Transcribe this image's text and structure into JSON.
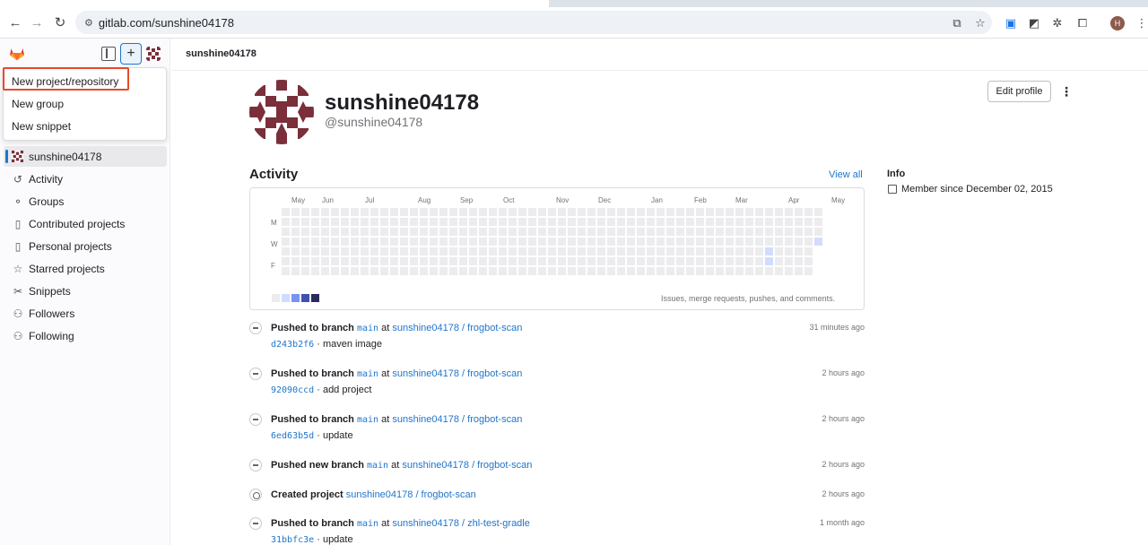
{
  "browser": {
    "url": "gitlab.com/sunshine04178",
    "back_icon": "arrow-left-icon",
    "forward_icon": "arrow-right-icon",
    "reload_icon": "reload-icon"
  },
  "sidebar": {
    "new_menu": {
      "items": [
        "New project/repository",
        "New group",
        "New snippet"
      ]
    },
    "nav": [
      {
        "label": "sunshine04178",
        "icon": "user-avatar-icon",
        "active": true
      },
      {
        "label": "Activity",
        "icon": "history-icon"
      },
      {
        "label": "Groups",
        "icon": "group-icon"
      },
      {
        "label": "Contributed projects",
        "icon": "project-icon"
      },
      {
        "label": "Personal projects",
        "icon": "project-icon"
      },
      {
        "label": "Starred projects",
        "icon": "star-icon"
      },
      {
        "label": "Snippets",
        "icon": "snippet-icon"
      },
      {
        "label": "Followers",
        "icon": "users-icon"
      },
      {
        "label": "Following",
        "icon": "users-icon"
      }
    ]
  },
  "topbar": {
    "breadcrumb": "sunshine04178"
  },
  "profile": {
    "name": "sunshine04178",
    "handle": "@sunshine04178",
    "edit_label": "Edit profile"
  },
  "activity": {
    "title": "Activity",
    "view_all": "View all",
    "months": [
      "May",
      "Jun",
      "Jul",
      "Aug",
      "Sep",
      "Oct",
      "Nov",
      "Dec",
      "Jan",
      "Feb",
      "Mar",
      "Apr",
      "May"
    ],
    "day_labels": [
      "M",
      "W",
      "F"
    ],
    "legend_text": "Issues, merge requests, pushes, and comments.",
    "legend_colors": [
      "#ececef",
      "#d2dcff",
      "#7992f5",
      "#3f51ae",
      "#2a2b59"
    ]
  },
  "info": {
    "title": "Info",
    "member_since": "Member since December 02, 2015"
  },
  "events": [
    {
      "action": "Pushed to branch",
      "branch": "main",
      "at": "at",
      "project": "sunshine04178 / frogbot-scan",
      "time": "31 minutes ago",
      "sha": "d243b2f6",
      "message": "maven image"
    },
    {
      "action": "Pushed to branch",
      "branch": "main",
      "at": "at",
      "project": "sunshine04178 / frogbot-scan",
      "time": "2 hours ago",
      "sha": "92090ccd",
      "message": "add project"
    },
    {
      "action": "Pushed to branch",
      "branch": "main",
      "at": "at",
      "project": "sunshine04178 / frogbot-scan",
      "time": "2 hours ago",
      "sha": "6ed63b5d",
      "message": "update"
    },
    {
      "action": "Pushed new branch",
      "branch": "main",
      "at": "at",
      "project": "sunshine04178 / frogbot-scan",
      "time": "2 hours ago"
    },
    {
      "action": "Created project",
      "project": "sunshine04178 / frogbot-scan",
      "time": "2 hours ago"
    },
    {
      "action": "Pushed to branch",
      "branch": "main",
      "at": "at",
      "project": "sunshine04178 / zhl-test-gradle",
      "time": "1 month ago",
      "sha": "31bbfc3e",
      "message": "update"
    }
  ]
}
